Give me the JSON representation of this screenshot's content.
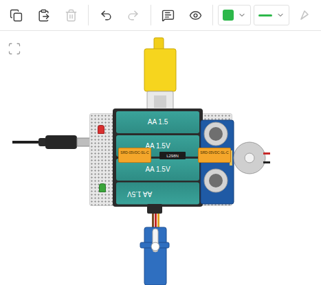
{
  "toolbar": {
    "buttons": [
      {
        "disabled": false
      },
      {
        "disabled": false
      },
      {
        "disabled": true
      },
      {
        "disabled": false
      },
      {
        "disabled": true
      },
      {
        "disabled": false
      },
      {
        "disabled": false
      }
    ],
    "fill_color": "#2db84a",
    "line_color": "#2db84a",
    "extra_tool": {
      "disabled": true
    }
  },
  "canvas": {
    "batteries": [
      {
        "label": "AA 1.5",
        "flipped": false
      },
      {
        "label": "AA 1.5V",
        "flipped": false
      },
      {
        "label": "AA 1.5V",
        "flipped": false
      },
      {
        "label": "AA 1.5V",
        "flipped": true
      }
    ],
    "relays": [
      {
        "label": "SRD-05VDC-SL-C"
      },
      {
        "label": "SRD-05VDC-SL-C"
      }
    ],
    "driver": {
      "label": "L298N"
    },
    "leds": [
      {
        "color": "#d93030"
      },
      {
        "color": "#3aa53a"
      }
    ]
  }
}
